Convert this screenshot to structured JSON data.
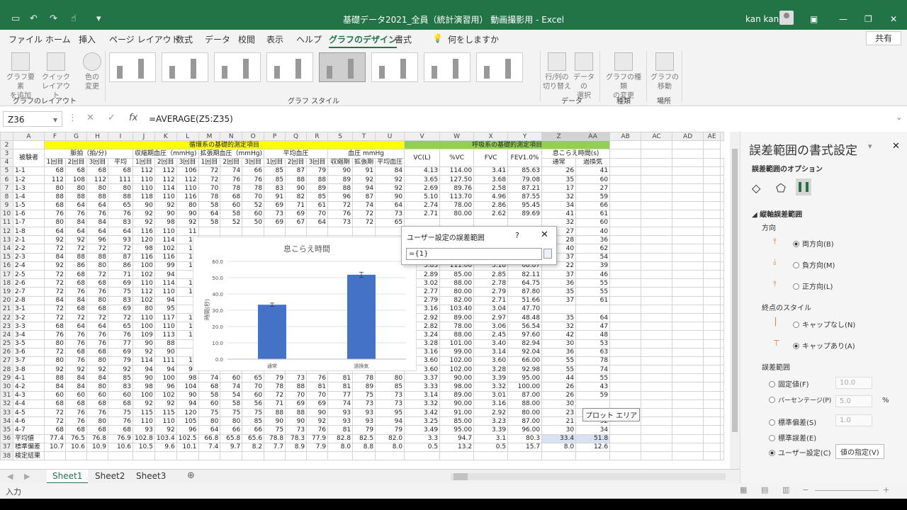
{
  "window": {
    "title": "基礎データ2021_全員（統計演習用） 動画撮影用 - Excel",
    "user": "kan kan"
  },
  "ribbon": {
    "tabs": [
      "ファイル",
      "ホーム",
      "挿入",
      "ページ レイアウト",
      "数式",
      "データ",
      "校閲",
      "表示",
      "ヘルプ",
      "グラフのデザイン",
      "書式"
    ],
    "search": "何をしますか",
    "share": "共有",
    "btn_add_element": "グラフ要素\nを追加",
    "btn_quick_layout": "クイック\nレイアウト",
    "btn_colors": "色の\n変更",
    "btn_switch": "行/列の\n切り替え",
    "btn_select_data": "データの\n選択",
    "btn_change_type": "グラフの種類\nの変更",
    "btn_move": "グラフの\n移動",
    "group_layout": "グラフのレイアウト",
    "group_style": "グラフ スタイル",
    "group_data": "データ",
    "group_type": "種類",
    "group_location": "場所"
  },
  "formula_bar": {
    "namebox": "Z36",
    "fx": "fx",
    "formula": "=AVERAGE(Z5:Z35)"
  },
  "sheet": {
    "columns": [
      "A",
      "F",
      "G",
      "H",
      "I",
      "J",
      "K",
      "L",
      "M",
      "N",
      "O",
      "P",
      "Q",
      "R",
      "S",
      "T",
      "U",
      "V",
      "W",
      "X",
      "Y",
      "Z",
      "AA",
      "AB",
      "AC",
      "AD",
      "AE"
    ],
    "header_rows": {
      "r2_cardio": "循環系の基礎的測定項目",
      "r2_resp": "呼吸系の基礎的測定項目",
      "subject": "被験者",
      "pulse": "脈拍（拍/分)",
      "sys": "収縮期血圧（mmHg)",
      "dia": "拡張期血圧（mmHg)",
      "mean": "平均血圧",
      "bp": "血圧 mmHg",
      "vc": "VC(L)",
      "pvc": "%VC",
      "fvc": "FVC",
      "fev": "FEV1.0%",
      "breath": "息こらえ時間(s)",
      "r4": [
        "1回目",
        "2回目",
        "3回目",
        "平均",
        "1回目",
        "2回目",
        "3回目",
        "1回目",
        "2回目",
        "3回目",
        "1回目",
        "2回目",
        "3回目",
        "収縮期",
        "拡張期",
        "平均血圧",
        "通常",
        "過換気"
      ]
    },
    "rows": [
      [
        "5",
        "1-1",
        "68",
        "68",
        "68",
        "68",
        "112",
        "112",
        "106",
        "72",
        "74",
        "66",
        "85",
        "87",
        "79",
        "90",
        "91",
        "84",
        "4.13",
        "114.00",
        "3.41",
        "85.63",
        "26",
        "41"
      ],
      [
        "6",
        "1-2",
        "112",
        "108",
        "112",
        "111",
        "110",
        "112",
        "112",
        "72",
        "76",
        "76",
        "85",
        "88",
        "88",
        "89",
        "92",
        "92",
        "3.65",
        "127.50",
        "3.68",
        "79.08",
        "35",
        "60"
      ],
      [
        "7",
        "1-3",
        "80",
        "80",
        "80",
        "80",
        "110",
        "114",
        "110",
        "70",
        "78",
        "78",
        "83",
        "90",
        "89",
        "88",
        "94",
        "92",
        "2.69",
        "89.76",
        "2.58",
        "87.21",
        "17",
        "27"
      ],
      [
        "8",
        "1-4",
        "88",
        "88",
        "88",
        "88",
        "118",
        "110",
        "116",
        "78",
        "68",
        "70",
        "91",
        "82",
        "85",
        "96",
        "87",
        "90",
        "5.10",
        "113.70",
        "4.96",
        "87.55",
        "32",
        "59"
      ],
      [
        "9",
        "1-5",
        "68",
        "64",
        "64",
        "65",
        "90",
        "92",
        "80",
        "58",
        "60",
        "52",
        "69",
        "71",
        "61",
        "72",
        "74",
        "64",
        "2.74",
        "78.00",
        "2.86",
        "95.45",
        "34",
        "66"
      ],
      [
        "10",
        "1-6",
        "76",
        "76",
        "76",
        "76",
        "92",
        "90",
        "90",
        "64",
        "58",
        "60",
        "73",
        "69",
        "70",
        "76",
        "72",
        "73",
        "2.71",
        "80.00",
        "2.62",
        "89.69",
        "41",
        "61"
      ],
      [
        "11",
        "1-7",
        "80",
        "84",
        "84",
        "83",
        "92",
        "98",
        "92",
        "58",
        "52",
        "50",
        "69",
        "67",
        "64",
        "73",
        "72",
        "65",
        "",
        "",
        "",
        "",
        "32",
        "60"
      ],
      [
        "12",
        "1-8",
        "64",
        "64",
        "64",
        "64",
        "116",
        "110",
        "11",
        "",
        "",
        "",
        "",
        "",
        "",
        "",
        "",
        "",
        "",
        "",
        "",
        "",
        "27",
        "40"
      ],
      [
        "13",
        "2-1",
        "92",
        "92",
        "96",
        "93",
        "120",
        "114",
        "11",
        "",
        "",
        "",
        "",
        "",
        "",
        "",
        "",
        "",
        "",
        "",
        "",
        "",
        "28",
        "36"
      ],
      [
        "14",
        "2-2",
        "72",
        "72",
        "72",
        "72",
        "98",
        "102",
        "10",
        "",
        "",
        "",
        "",
        "",
        "",
        "",
        "",
        "",
        "",
        "",
        "",
        "",
        "40",
        "62"
      ],
      [
        "15",
        "2-3",
        "84",
        "88",
        "88",
        "87",
        "116",
        "116",
        "10",
        "",
        "",
        "",
        "",
        "",
        "",
        "",
        "",
        "",
        "",
        "",
        "",
        "",
        "37",
        "54"
      ],
      [
        "16",
        "2-4",
        "92",
        "86",
        "80",
        "86",
        "100",
        "99",
        "10",
        "",
        "",
        "",
        "",
        "",
        "",
        "",
        "",
        "",
        "3.83",
        "111.00",
        "3.18",
        "68.87",
        "22",
        "39"
      ],
      [
        "17",
        "2-5",
        "72",
        "68",
        "72",
        "71",
        "102",
        "94",
        "9",
        "",
        "",
        "",
        "",
        "",
        "",
        "",
        "",
        "",
        "2.89",
        "85.00",
        "2.85",
        "82.11",
        "37",
        "46"
      ],
      [
        "18",
        "2-6",
        "72",
        "68",
        "68",
        "69",
        "110",
        "114",
        "11",
        "",
        "",
        "",
        "",
        "",
        "",
        "",
        "",
        "",
        "3.02",
        "88.00",
        "2.78",
        "64.75",
        "36",
        "55"
      ],
      [
        "19",
        "2-7",
        "72",
        "76",
        "76",
        "75",
        "112",
        "110",
        "11",
        "",
        "",
        "",
        "",
        "",
        "",
        "",
        "",
        "",
        "2.77",
        "80.00",
        "2.79",
        "87.80",
        "35",
        "55"
      ],
      [
        "20",
        "2-8",
        "84",
        "84",
        "80",
        "83",
        "102",
        "94",
        "9",
        "",
        "",
        "",
        "",
        "",
        "",
        "",
        "",
        "",
        "2.79",
        "82.00",
        "2.71",
        "51.66",
        "37",
        "61"
      ],
      [
        "21",
        "3-1",
        "72",
        "68",
        "68",
        "69",
        "80",
        "95",
        "9",
        "",
        "",
        "",
        "",
        "",
        "",
        "",
        "",
        "",
        "3.16",
        "103.40",
        "3.04",
        "47.70",
        "",
        ""
      ],
      [
        "22",
        "3-2",
        "72",
        "72",
        "72",
        "72",
        "110",
        "117",
        "10",
        "",
        "",
        "",
        "",
        "",
        "",
        "",
        "",
        "",
        "2.92",
        "89.00",
        "2.97",
        "48.48",
        "35",
        "64"
      ],
      [
        "23",
        "3-3",
        "68",
        "64",
        "64",
        "65",
        "100",
        "110",
        "12",
        "",
        "",
        "",
        "",
        "",
        "",
        "",
        "",
        "",
        "2.82",
        "78.00",
        "3.06",
        "56.54",
        "32",
        "47"
      ],
      [
        "24",
        "3-4",
        "76",
        "76",
        "76",
        "76",
        "109",
        "113",
        "10",
        "",
        "",
        "",
        "",
        "",
        "",
        "",
        "",
        "",
        "3.24",
        "88.00",
        "2.45",
        "97.60",
        "42",
        "48"
      ],
      [
        "25",
        "3-5",
        "80",
        "76",
        "76",
        "77",
        "90",
        "88",
        "8",
        "",
        "",
        "",
        "",
        "",
        "",
        "",
        "",
        "",
        "3.28",
        "101.00",
        "3.40",
        "82.94",
        "30",
        "53"
      ],
      [
        "26",
        "3-6",
        "72",
        "68",
        "68",
        "69",
        "92",
        "90",
        "9",
        "",
        "",
        "",
        "",
        "",
        "",
        "",
        "",
        "",
        "3.16",
        "99.00",
        "3.14",
        "92.04",
        "36",
        "63"
      ],
      [
        "27",
        "3-7",
        "80",
        "76",
        "80",
        "79",
        "114",
        "111",
        "10",
        "",
        "",
        "",
        "",
        "",
        "",
        "",
        "",
        "",
        "3.60",
        "102.00",
        "3.60",
        "66.00",
        "55",
        "78"
      ],
      [
        "28",
        "3-8",
        "92",
        "92",
        "92",
        "92",
        "94",
        "94",
        "96",
        "66",
        "62",
        "60",
        "75",
        "73",
        "76",
        "78",
        "76",
        "79",
        "3.60",
        "102.00",
        "3.28",
        "92.98",
        "55",
        "74"
      ],
      [
        "29",
        "4-1",
        "88",
        "84",
        "84",
        "85",
        "90",
        "100",
        "98",
        "74",
        "60",
        "65",
        "79",
        "73",
        "76",
        "81",
        "78",
        "80",
        "3.37",
        "90.00",
        "3.39",
        "95.00",
        "44",
        "55"
      ],
      [
        "30",
        "4-2",
        "84",
        "84",
        "80",
        "83",
        "98",
        "96",
        "104",
        "68",
        "74",
        "70",
        "78",
        "88",
        "81",
        "81",
        "89",
        "85",
        "3.33",
        "98.00",
        "3.32",
        "100.00",
        "26",
        "43"
      ],
      [
        "31",
        "4-3",
        "60",
        "60",
        "60",
        "60",
        "100",
        "102",
        "90",
        "58",
        "54",
        "60",
        "72",
        "70",
        "70",
        "77",
        "75",
        "73",
        "3.14",
        "89.00",
        "3.01",
        "87.00",
        "26",
        "59"
      ],
      [
        "32",
        "4-4",
        "68",
        "68",
        "68",
        "68",
        "92",
        "92",
        "94",
        "60",
        "58",
        "56",
        "71",
        "69",
        "69",
        "74",
        "73",
        "73",
        "3.32",
        "90.00",
        "3.16",
        "88.00",
        "30",
        ""
      ],
      [
        "33",
        "4-5",
        "72",
        "76",
        "76",
        "75",
        "115",
        "115",
        "120",
        "75",
        "75",
        "75",
        "88",
        "88",
        "90",
        "93",
        "93",
        "95",
        "3.42",
        "91.00",
        "2.92",
        "80.00",
        "23",
        ""
      ],
      [
        "34",
        "4-6",
        "72",
        "76",
        "80",
        "76",
        "110",
        "110",
        "105",
        "80",
        "80",
        "85",
        "90",
        "90",
        "92",
        "93",
        "93",
        "94",
        "3.25",
        "85.00",
        "3.23",
        "87.00",
        "21",
        "32"
      ],
      [
        "35",
        "4-7",
        "68",
        "68",
        "68",
        "68",
        "93",
        "92",
        "96",
        "64",
        "66",
        "66",
        "75",
        "73",
        "76",
        "81",
        "79",
        "79",
        "3.49",
        "95.00",
        "3.39",
        "96.00",
        "30",
        "34"
      ],
      [
        "36",
        "平均値",
        "77.4",
        "76.5",
        "76.8",
        "76.9",
        "102.8",
        "103.4",
        "102.5",
        "66.8",
        "65.8",
        "65.6",
        "78.8",
        "78.3",
        "77.9",
        "82.8",
        "82.5",
        "82.0",
        "3.3",
        "94.7",
        "3.1",
        "80.3",
        "33.4",
        "51.8"
      ],
      [
        "37",
        "標準偏差",
        "10.7",
        "10.6",
        "10.9",
        "10.6",
        "10.5",
        "9.6",
        "10.1",
        "7.4",
        "9.7",
        "8.2",
        "7.7",
        "8.9",
        "7.9",
        "8.0",
        "8.8",
        "8.0",
        "0.5",
        "13.2",
        "0.5",
        "15.7",
        "8.0",
        "12.6"
      ],
      [
        "38",
        "検定結果",
        "",
        "",
        "",
        "",
        "",
        "",
        "",
        "",
        "",
        "",
        "",
        "",
        "",
        "",
        "",
        "",
        "",
        "",
        "",
        "",
        "",
        ""
      ]
    ]
  },
  "chart_data": {
    "type": "bar",
    "title": "息こらえ時間",
    "ylabel": "時間(秒)",
    "categories": [
      "通常",
      "過換気"
    ],
    "values": [
      33.4,
      51.8
    ],
    "error": [
      8.0,
      12.6
    ],
    "ylim": [
      0,
      60
    ],
    "yticks": [
      "0.0",
      "10.0",
      "20.0",
      "30.0",
      "40.0",
      "50.0",
      "60.0"
    ],
    "color": "#4472c4",
    "grid": true
  },
  "dialog": {
    "title": "ユーザー設定の誤差範囲",
    "help": "?",
    "value": "={1}"
  },
  "pane": {
    "title": "誤差範囲の書式設定",
    "options": "誤差範囲のオプション",
    "section": "縦軸誤差範囲",
    "direction": "方向",
    "dir_both": "両方向(B)",
    "dir_minus": "負方向(M)",
    "dir_plus": "正方向(L)",
    "end_style": "終点のスタイル",
    "no_cap": "キャップなし(N)",
    "cap": "キャップあり(A)",
    "amount": "誤差範囲",
    "fixed": "固定値(F)",
    "fixed_val": "10.0",
    "pct": "パーセンテージ(P)",
    "pct_val": "5.0",
    "pct_unit": "%",
    "stdev": "標準偏差(S)",
    "stdev_val": "1.0",
    "stderr": "標準誤差(E)",
    "custom": "ユーザー設定(C)",
    "specify": "値の指定(V)"
  },
  "tooltip": "プロット エリア",
  "sheets": [
    "Sheet1",
    "Sheet2",
    "Sheet3"
  ],
  "status": {
    "mode": "入力"
  }
}
